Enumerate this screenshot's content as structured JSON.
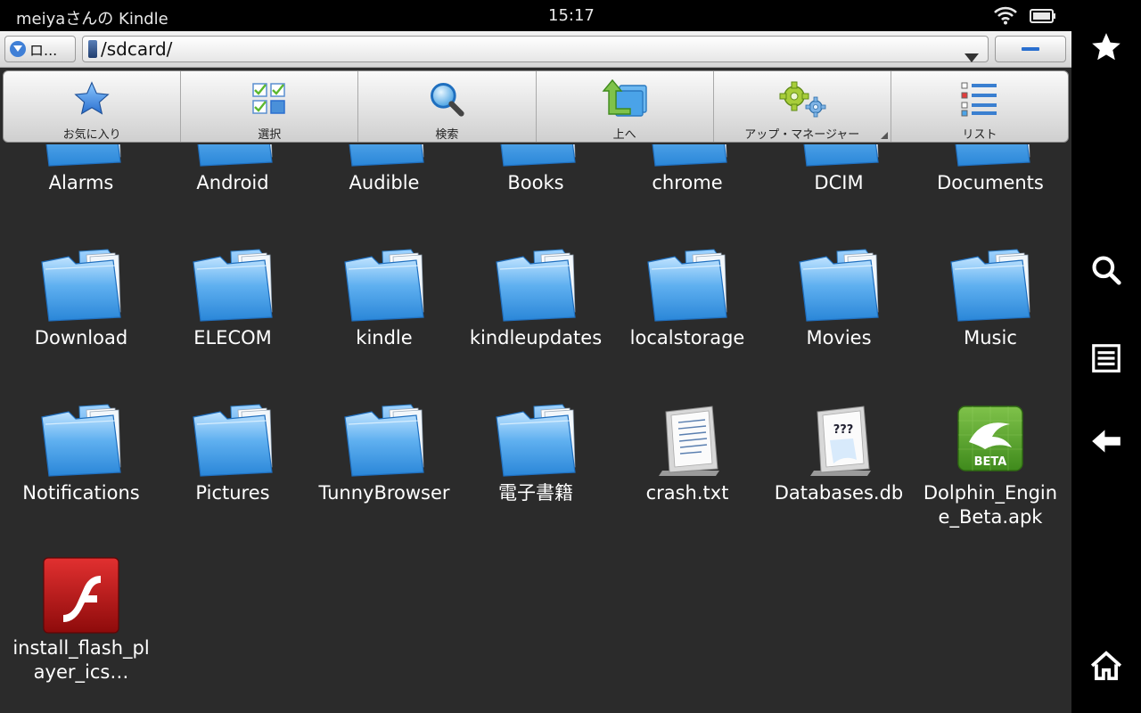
{
  "status_bar": {
    "owner": "meiyaさんの Kindle",
    "time": "15:17"
  },
  "address_bar": {
    "quick_label": "ロ...",
    "path": "/sdcard/"
  },
  "toolbar": {
    "items": [
      {
        "label": "お気に入り",
        "icon": "star-icon"
      },
      {
        "label": "選択",
        "icon": "select-checklist-icon"
      },
      {
        "label": "検索",
        "icon": "magnifier-icon"
      },
      {
        "label": "上へ",
        "icon": "up-folder-icon"
      },
      {
        "label": "アップ・マネージャー",
        "icon": "gears-icon"
      },
      {
        "label": "リスト",
        "icon": "list-view-icon"
      }
    ]
  },
  "files": [
    {
      "name": "Alarms",
      "type": "folder"
    },
    {
      "name": "Android",
      "type": "folder"
    },
    {
      "name": "Audible",
      "type": "folder"
    },
    {
      "name": "Books",
      "type": "folder"
    },
    {
      "name": "chrome",
      "type": "folder"
    },
    {
      "name": "DCIM",
      "type": "folder"
    },
    {
      "name": "Documents",
      "type": "folder"
    },
    {
      "name": "Download",
      "type": "folder"
    },
    {
      "name": "ELECOM",
      "type": "folder"
    },
    {
      "name": "kindle",
      "type": "folder"
    },
    {
      "name": "kindleupdates",
      "type": "folder"
    },
    {
      "name": "localstorage",
      "type": "folder"
    },
    {
      "name": "Movies",
      "type": "folder"
    },
    {
      "name": "Music",
      "type": "folder"
    },
    {
      "name": "Notifications",
      "type": "folder"
    },
    {
      "name": "Pictures",
      "type": "folder"
    },
    {
      "name": "TunnyBrowser",
      "type": "folder"
    },
    {
      "name": "電子書籍",
      "type": "folder"
    },
    {
      "name": "crash.txt",
      "type": "text"
    },
    {
      "name": "Databases.db",
      "type": "unknown"
    },
    {
      "name": "Dolphin_Engine_Beta.apk",
      "type": "apk",
      "badge": "BETA"
    },
    {
      "name": "install_flash_player_ics…",
      "type": "flash"
    }
  ],
  "nav_rail": {
    "icons": [
      "favorite-star-icon",
      "search-icon",
      "menu-icon",
      "back-icon",
      "home-icon"
    ]
  },
  "colors": {
    "background": "#2b2b2b",
    "folder_blue": "#4aa3e8",
    "accent": "#2a6fcf"
  }
}
